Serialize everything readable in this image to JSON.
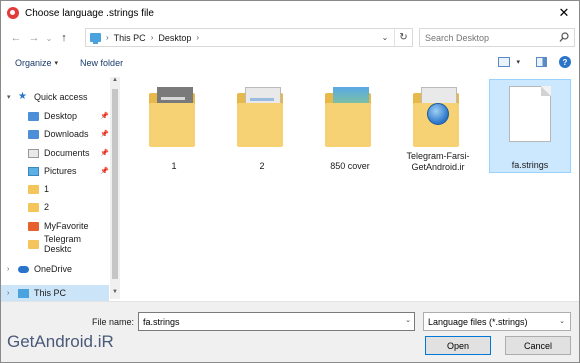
{
  "window": {
    "title": "Choose language .strings file",
    "close_glyph": "✕",
    "accent": "#0078d7"
  },
  "nav": {
    "back_glyph": "←",
    "forward_glyph": "→",
    "recent_glyph": "⌄",
    "up_glyph": "↑"
  },
  "address": {
    "crumbs": [
      "This PC",
      "Desktop"
    ],
    "separator": "›",
    "dropdown_glyph": "⌄",
    "refresh_glyph": "↻"
  },
  "search": {
    "placeholder": "Search Desktop"
  },
  "commands": {
    "organize": "Organize",
    "organize_caret": "▾",
    "new_folder": "New folder",
    "view_caret": "▾",
    "help": "?"
  },
  "sidebar": {
    "items": [
      {
        "label": "Quick access",
        "icon": "star-icon"
      },
      {
        "label": "Desktop",
        "icon": "desktop-folder-icon",
        "pinned": "📌"
      },
      {
        "label": "Downloads",
        "icon": "download-icon",
        "pinned": "📌"
      },
      {
        "label": "Documents",
        "icon": "documents-icon",
        "pinned": "📌"
      },
      {
        "label": "Pictures",
        "icon": "pictures-icon",
        "pinned": "📌"
      },
      {
        "label": "1",
        "icon": "folder-icon"
      },
      {
        "label": "2",
        "icon": "folder-icon"
      },
      {
        "label": "MyFavorite",
        "icon": "myfavorite-icon"
      },
      {
        "label": "Telegram Desktc",
        "icon": "folder-icon"
      },
      {
        "label": "OneDrive",
        "icon": "onedrive-icon"
      },
      {
        "label": "This PC",
        "icon": "this-pc-icon"
      }
    ],
    "expand_glyph": "›"
  },
  "files": [
    {
      "label": "1",
      "kind": "folder"
    },
    {
      "label": "2",
      "kind": "folder"
    },
    {
      "label": "850 cover",
      "kind": "folder"
    },
    {
      "label": "Telegram-Farsi-GetAndroid.ir",
      "kind": "folder"
    },
    {
      "label": "fa.strings",
      "kind": "file",
      "selected": true
    }
  ],
  "bottom": {
    "file_name_label": "File name:",
    "file_name_value": "fa.strings",
    "file_type": "Language files (*.strings)",
    "open_label": "Open",
    "cancel_label": "Cancel",
    "dropdown_glyph": "⌄"
  },
  "watermark": "GetAndroid.iR"
}
